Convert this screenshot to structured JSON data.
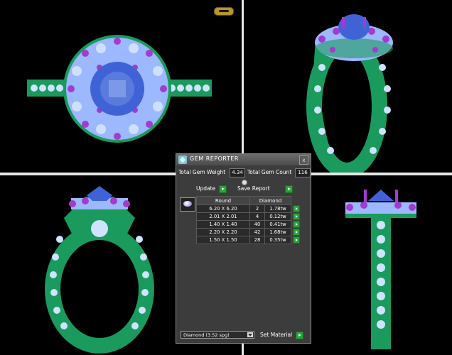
{
  "panel": {
    "title": "GEM REPORTER",
    "close_label": "x",
    "total_gem_weight_label": "Total Gem Weight",
    "total_gem_weight_value": "4.34",
    "total_gem_count_label": "Total Gem Count",
    "total_gem_count_value": "116",
    "update_label": "Update",
    "save_report_label": "Save Report",
    "table": {
      "headers": [
        "Round",
        "Diamond"
      ],
      "rows": [
        {
          "size": "6.20 X 6.20",
          "count": "2",
          "weight": "1.78tw"
        },
        {
          "size": "2.01 X 2.01",
          "count": "4",
          "weight": "0.12tw"
        },
        {
          "size": "1.40 X 1.40",
          "count": "40",
          "weight": "0.41tw"
        },
        {
          "size": "2.20 X 2.20",
          "count": "42",
          "weight": "1.68tw"
        },
        {
          "size": "1.50 X 1.50",
          "count": "28",
          "weight": "0.35tw"
        }
      ]
    },
    "material_select_value": "Diamond    (3.52 spg)",
    "set_material_label": "Set Material"
  },
  "colors": {
    "metal": "#1a9a5c",
    "gem_stone": "#8fb3ff",
    "prong": "#8a2be2",
    "center_stone": "#3f63d6",
    "go_button": "#27a33a"
  }
}
